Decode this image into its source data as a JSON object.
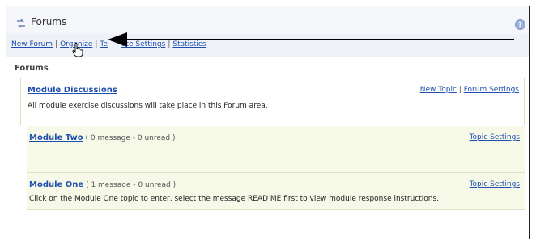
{
  "header": {
    "title": "Forums",
    "help_icon": "question-mark-icon"
  },
  "toolbar": {
    "items": [
      "New Forum",
      "Organize",
      "Template Settings",
      "Statistics"
    ],
    "visible": [
      "New Forum",
      "Organize",
      "Te",
      "ate Settings",
      "Statistics"
    ]
  },
  "section_title": "Forums",
  "forum": {
    "name": "Module Discussions",
    "new_topic": "New Topic",
    "forum_settings": "Forum Settings",
    "description": "All module exercise discussions will take place in this Forum area."
  },
  "topics": [
    {
      "name": "Module Two",
      "meta": "( 0 message - 0 unread )",
      "settings": "Topic Settings",
      "description": ""
    },
    {
      "name": "Module One",
      "meta": "( 1 message - 0 unread )",
      "settings": "Topic Settings",
      "description": "Click on the Module One topic to enter, select the message READ ME first to view module response instructions."
    }
  ],
  "colors": {
    "link": "#1f4fae",
    "topic_bg": "#f7f9e8",
    "toolbar_bg": "#eef1f7"
  }
}
